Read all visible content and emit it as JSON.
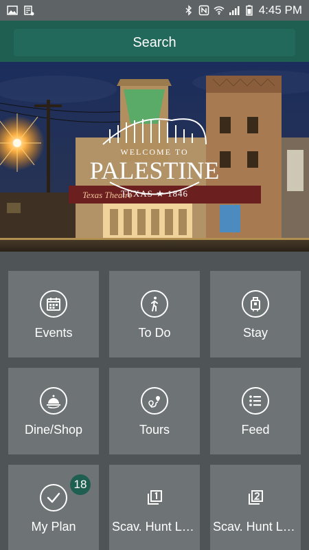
{
  "status_bar": {
    "time": "4:45 PM",
    "left_icons": [
      "image-icon",
      "cast-icon"
    ],
    "right_icons": [
      "bluetooth-icon",
      "nfc-icon",
      "wifi-icon",
      "signal-icon",
      "battery-icon"
    ]
  },
  "header": {
    "search_label": "Search"
  },
  "hero": {
    "sign_top": "WELCOME TO",
    "sign_main": "PALESTINE",
    "sign_bottom": "TEXAS ★ 1846",
    "marquee_text": "Texas Theatre"
  },
  "tiles": [
    {
      "label": "Events",
      "icon": "calendar-icon"
    },
    {
      "label": "To Do",
      "icon": "walking-person-icon"
    },
    {
      "label": "Stay",
      "icon": "luggage-icon"
    },
    {
      "label": "Dine/Shop",
      "icon": "cloche-icon"
    },
    {
      "label": "Tours",
      "icon": "route-icon"
    },
    {
      "label": "Feed",
      "icon": "list-icon"
    },
    {
      "label": "My Plan",
      "icon": "checkmark-icon",
      "badge": "18"
    },
    {
      "label": "Scav. Hunt Lv...",
      "icon": "filter-1-icon"
    },
    {
      "label": "Scav. Hunt Lv...",
      "icon": "filter-2-icon"
    }
  ],
  "colors": {
    "header": "#1f5f52",
    "search_box": "#22695b",
    "background": "#4f5557",
    "tile": "#6e7476",
    "badge": "#1f5f52"
  }
}
